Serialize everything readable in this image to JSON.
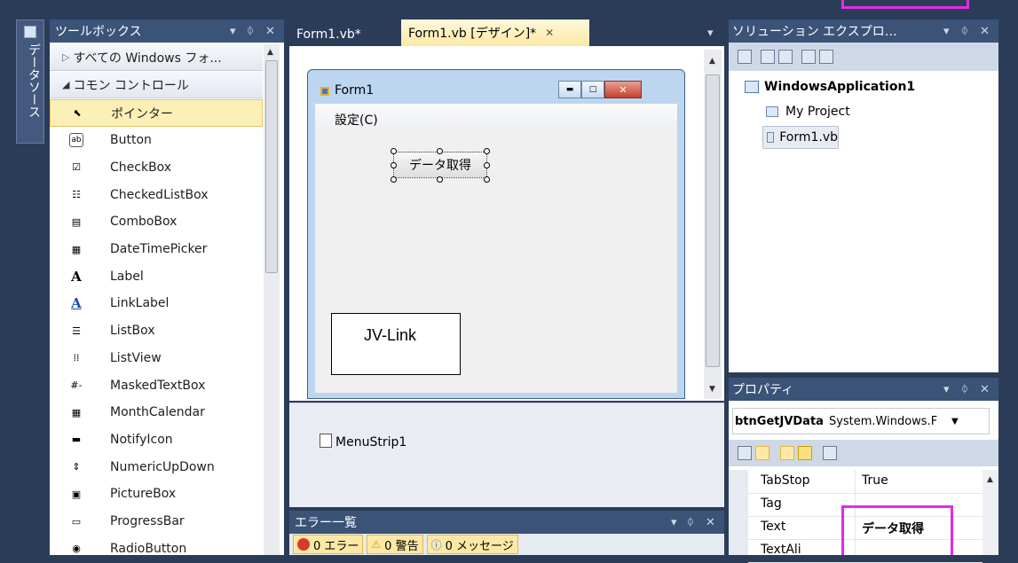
{
  "datasource_strip": {
    "label": "データソース"
  },
  "toolbox": {
    "title": "ツールボックス",
    "buttons": [
      "▾",
      "ᛰ",
      "✕"
    ],
    "groups": [
      "すべての Windows フォ...",
      "コモン コントロール"
    ],
    "items": [
      {
        "icon": "pointer-icon",
        "label": "ポインター"
      },
      {
        "icon": "button-icon",
        "label": "Button"
      },
      {
        "icon": "checkbox-icon",
        "label": "CheckBox"
      },
      {
        "icon": "checkedlistbox-icon",
        "label": "CheckedListBox"
      },
      {
        "icon": "combobox-icon",
        "label": "ComboBox"
      },
      {
        "icon": "datetimepicker-icon",
        "label": "DateTimePicker"
      },
      {
        "icon": "label-icon",
        "label": "Label"
      },
      {
        "icon": "linklabel-icon",
        "label": "LinkLabel"
      },
      {
        "icon": "listbox-icon",
        "label": "ListBox"
      },
      {
        "icon": "listview-icon",
        "label": "ListView"
      },
      {
        "icon": "maskedtextbox-icon",
        "label": "MaskedTextBox"
      },
      {
        "icon": "monthcalendar-icon",
        "label": "MonthCalendar"
      },
      {
        "icon": "notifyicon-icon",
        "label": "NotifyIcon"
      },
      {
        "icon": "numericupdown-icon",
        "label": "NumericUpDown"
      },
      {
        "icon": "picturebox-icon",
        "label": "PictureBox"
      },
      {
        "icon": "progressbar-icon",
        "label": "ProgressBar"
      },
      {
        "icon": "radiobutton-icon",
        "label": "RadioButton"
      }
    ]
  },
  "editor": {
    "tabs": [
      {
        "label": "Form1.vb*",
        "active": false
      },
      {
        "label": "Form1.vb [デザイン]*",
        "active": true
      }
    ],
    "close_glyph": "✕",
    "dropdown_glyph": "▾",
    "form": {
      "title": "Form1",
      "menu": "設定(C)",
      "button_text": "データ取得",
      "jvlink_label": "JV-Link"
    },
    "tray_component": "MenuStrip1"
  },
  "errors": {
    "title": "エラー一覧",
    "buttons": [
      "▾",
      "ᛰ",
      "✕"
    ],
    "filters": [
      "0 エラー",
      "0 警告",
      "0 メッセージ"
    ]
  },
  "solution": {
    "title": "ソリューション エクスプロ…",
    "buttons": [
      "▾",
      "ᛰ",
      "✕"
    ],
    "project": "WindowsApplication1",
    "items": [
      "My Project",
      "Form1.vb"
    ]
  },
  "properties": {
    "title": "プロパティ",
    "buttons": [
      "▾",
      "ᛰ",
      "✕"
    ],
    "object": "btnGetJVData",
    "object_type": "System.Windows.F",
    "rows": [
      {
        "name": "TabStop",
        "value": "True"
      },
      {
        "name": "Tag",
        "value": ""
      },
      {
        "name": "Text",
        "value": "データ取得"
      },
      {
        "name": "TextAli",
        "value": ""
      }
    ]
  },
  "colors": {
    "highlight": "#e22be6",
    "panel_title": "#3c5378",
    "selection": "#fdf0b7"
  }
}
